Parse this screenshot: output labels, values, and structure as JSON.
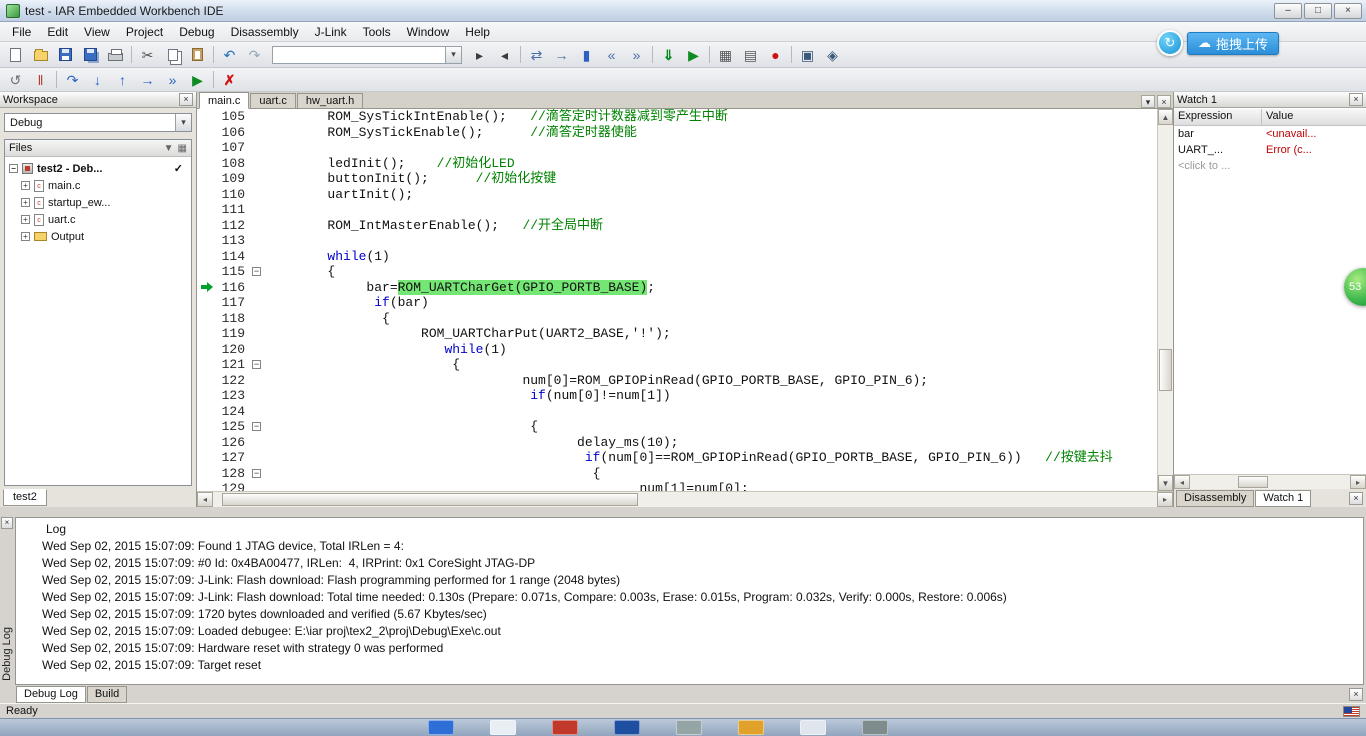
{
  "window": {
    "title": "test - IAR Embedded Workbench IDE"
  },
  "titlebar_icons": {
    "minimize": "–",
    "maximize": "□",
    "close": "×"
  },
  "menu": {
    "items": [
      "File",
      "Edit",
      "View",
      "Project",
      "Debug",
      "Disassembly",
      "J-Link",
      "Tools",
      "Window",
      "Help"
    ]
  },
  "toolbar_main": {
    "items": [
      {
        "t": "btn",
        "name": "new-file",
        "icon": "page"
      },
      {
        "t": "btn",
        "name": "open-file",
        "icon": "folder"
      },
      {
        "t": "btn",
        "name": "save",
        "icon": "floppy"
      },
      {
        "t": "btn",
        "name": "save-all",
        "icon": "floppy2"
      },
      {
        "t": "btn",
        "name": "print",
        "icon": "printer"
      },
      {
        "t": "sep"
      },
      {
        "t": "btn",
        "name": "cut",
        "icon": "g",
        "g": "✂",
        "c": "#50524f"
      },
      {
        "t": "btn",
        "name": "copy",
        "icon": "pages"
      },
      {
        "t": "btn",
        "name": "paste",
        "icon": "clip"
      },
      {
        "t": "sep"
      },
      {
        "t": "btn",
        "name": "undo",
        "icon": "g",
        "g": "↶",
        "c": "#1d6fb8"
      },
      {
        "t": "btn",
        "name": "redo",
        "icon": "g",
        "g": "↷",
        "c": "#94a8b8"
      },
      {
        "t": "combo",
        "name": "find-combo"
      },
      {
        "t": "btn",
        "name": "find-next",
        "icon": "g",
        "g": "▸",
        "c": "#3a3c3a"
      },
      {
        "t": "btn",
        "name": "find-previous",
        "icon": "g",
        "g": "◂",
        "c": "#3a3c3a"
      },
      {
        "t": "sep"
      },
      {
        "t": "btn",
        "name": "replace",
        "icon": "g",
        "g": "⇄",
        "c": "#4a6ea8"
      },
      {
        "t": "btn",
        "name": "goto-line",
        "icon": "g",
        "g": "→",
        "c": "#4a6ea8"
      },
      {
        "t": "btn",
        "name": "toggle-bookmark",
        "icon": "g",
        "g": "▮",
        "c": "#2d62c4"
      },
      {
        "t": "btn",
        "name": "previous-bookmark",
        "icon": "g",
        "g": "«",
        "c": "#4a6ea8"
      },
      {
        "t": "btn",
        "name": "next-bookmark",
        "icon": "g",
        "g": "»",
        "c": "#4a6ea8"
      },
      {
        "t": "sep"
      },
      {
        "t": "btn",
        "name": "download-and-debug",
        "icon": "g",
        "g": "⇓",
        "c": "#0d8a22",
        "b": 1
      },
      {
        "t": "btn",
        "name": "debug-without-downloading",
        "icon": "g",
        "g": "▶",
        "c": "#0d8a22"
      },
      {
        "t": "sep"
      },
      {
        "t": "btn",
        "name": "make",
        "icon": "g",
        "g": "▦",
        "c": "#56585a"
      },
      {
        "t": "btn",
        "name": "compile",
        "icon": "g",
        "g": "▤",
        "c": "#56585a"
      },
      {
        "t": "btn",
        "name": "toggle-breakpoint",
        "icon": "g",
        "g": "●",
        "c": "#cc1111"
      },
      {
        "t": "sep"
      },
      {
        "t": "btn",
        "name": "jlink-control-panel",
        "icon": "g",
        "g": "▣",
        "c": "#3a5a7a"
      },
      {
        "t": "btn",
        "name": "jlink-memory",
        "icon": "g",
        "g": "◈",
        "c": "#3a5a7a"
      }
    ]
  },
  "toolbar_debug": {
    "items": [
      {
        "t": "btn",
        "name": "reset",
        "icon": "g",
        "g": "↺",
        "c": "#6f7276"
      },
      {
        "t": "btn",
        "name": "break",
        "icon": "g",
        "g": "‖",
        "c": "#b33a2a"
      },
      {
        "t": "sep"
      },
      {
        "t": "btn",
        "name": "step-over",
        "icon": "g",
        "g": "↷",
        "c": "#2d62c4"
      },
      {
        "t": "btn",
        "name": "step-into",
        "icon": "g",
        "g": "↓",
        "c": "#2d62c4"
      },
      {
        "t": "btn",
        "name": "step-out",
        "icon": "g",
        "g": "↑",
        "c": "#2d62c4"
      },
      {
        "t": "btn",
        "name": "next-statement",
        "icon": "g",
        "g": "→",
        "c": "#2d62c4"
      },
      {
        "t": "btn",
        "name": "run-to-cursor",
        "icon": "g",
        "g": "»",
        "c": "#2d62c4"
      },
      {
        "t": "btn",
        "name": "go",
        "icon": "g",
        "g": "▶",
        "c": "#0d8a22"
      },
      {
        "t": "sep"
      },
      {
        "t": "btn",
        "name": "stop-debugging",
        "icon": "g",
        "g": "✗",
        "c": "#d31515",
        "b": 1
      }
    ]
  },
  "overlay": {
    "upload_label": "拖拽上传",
    "upload_icon": "↻",
    "cloud_icon": "☁",
    "ball_label": "53"
  },
  "workspace": {
    "title": "Workspace",
    "config": "Debug",
    "files_header": "Files",
    "project": {
      "label": "test2 - Deb...",
      "check": "✓"
    },
    "tree": [
      {
        "label": "main.c",
        "icon": "c-file"
      },
      {
        "label": "startup_ew...",
        "icon": "c-file"
      },
      {
        "label": "uart.c",
        "icon": "c-file"
      },
      {
        "label": "Output",
        "icon": "folder"
      }
    ],
    "bottom_tab": "test2"
  },
  "editor": {
    "tabs": [
      {
        "label": "main.c",
        "active": true
      },
      {
        "label": "uart.c",
        "active": false
      },
      {
        "label": "hw_uart.h",
        "active": false
      }
    ],
    "lines": [
      {
        "n": 105,
        "s": [
          {
            "t": "        ROM_SysTickIntEnable();   "
          },
          {
            "t": "//滴答定时计数器减到零产生中断",
            "c": "c"
          }
        ]
      },
      {
        "n": 106,
        "s": [
          {
            "t": "        ROM_SysTickEnable();      "
          },
          {
            "t": "//滴答定时器使能",
            "c": "c"
          }
        ]
      },
      {
        "n": 107,
        "s": []
      },
      {
        "n": 108,
        "s": [
          {
            "t": "        ledInit();    "
          },
          {
            "t": "//初始化LED",
            "c": "c"
          }
        ]
      },
      {
        "n": 109,
        "s": [
          {
            "t": "        buttonInit();      "
          },
          {
            "t": "//初始化按键",
            "c": "c"
          }
        ]
      },
      {
        "n": 110,
        "s": [
          {
            "t": "        uartInit();"
          }
        ]
      },
      {
        "n": 111,
        "s": []
      },
      {
        "n": 112,
        "s": [
          {
            "t": "        ROM_IntMasterEnable();   "
          },
          {
            "t": "//开全局中断",
            "c": "c"
          }
        ]
      },
      {
        "n": 113,
        "s": []
      },
      {
        "n": 114,
        "s": [
          {
            "t": "        "
          },
          {
            "t": "while",
            "c": "k"
          },
          {
            "t": "(1)"
          }
        ]
      },
      {
        "n": 115,
        "fold": true,
        "s": [
          {
            "t": "        {"
          }
        ]
      },
      {
        "n": 116,
        "arrow": true,
        "s": [
          {
            "t": "             bar="
          },
          {
            "t": "ROM_UARTCharGet(GPIO_PORTB_BASE)",
            "c": "hl"
          },
          {
            "t": ";"
          }
        ]
      },
      {
        "n": 117,
        "s": [
          {
            "t": "              "
          },
          {
            "t": "if",
            "c": "k"
          },
          {
            "t": "(bar)"
          }
        ]
      },
      {
        "n": 118,
        "s": [
          {
            "t": "               {"
          }
        ]
      },
      {
        "n": 119,
        "s": [
          {
            "t": "                    ROM_UARTCharPut(UART2_BASE,'!');"
          }
        ]
      },
      {
        "n": 120,
        "s": [
          {
            "t": "                       "
          },
          {
            "t": "while",
            "c": "k"
          },
          {
            "t": "(1)"
          }
        ]
      },
      {
        "n": 121,
        "fold": true,
        "s": [
          {
            "t": "                        {"
          }
        ]
      },
      {
        "n": 122,
        "s": [
          {
            "t": "                                 num[0]=ROM_GPIOPinRead(GPIO_PORTB_BASE, GPIO_PIN_6);"
          }
        ]
      },
      {
        "n": 123,
        "s": [
          {
            "t": "                                  "
          },
          {
            "t": "if",
            "c": "k"
          },
          {
            "t": "(num[0]!=num[1])"
          }
        ]
      },
      {
        "n": 124,
        "s": []
      },
      {
        "n": 125,
        "fold": true,
        "s": [
          {
            "t": "                                  {"
          }
        ]
      },
      {
        "n": 126,
        "s": [
          {
            "t": "                                        delay_ms(10);"
          }
        ]
      },
      {
        "n": 127,
        "s": [
          {
            "t": "                                         "
          },
          {
            "t": "if",
            "c": "k"
          },
          {
            "t": "(num[0]==ROM_GPIOPinRead(GPIO_PORTB_BASE, GPIO_PIN_6))   "
          },
          {
            "t": "//按键去抖",
            "c": "c"
          }
        ]
      },
      {
        "n": 128,
        "fold": true,
        "s": [
          {
            "t": "                                          {"
          }
        ]
      },
      {
        "n": 129,
        "s": [
          {
            "t": "                                                num[1]=num[0];"
          }
        ]
      }
    ]
  },
  "watch": {
    "title": "Watch 1",
    "columns": [
      "Expression",
      "Value"
    ],
    "rows": [
      {
        "expr": "bar",
        "value": "<unavail...",
        "value_style": "err"
      },
      {
        "expr": "UART_...",
        "value": "Error (c...",
        "value_style": "err"
      },
      {
        "expr": "<click to ...",
        "value": "",
        "expr_style": "ph"
      }
    ],
    "tabs": [
      {
        "label": "Disassembly",
        "active": false
      },
      {
        "label": "Watch 1",
        "active": true
      }
    ]
  },
  "log": {
    "title": "Log",
    "side_label": "Debug Log",
    "lines": [
      "Wed Sep 02, 2015 15:07:09: Found 1 JTAG device, Total IRLen = 4:",
      "Wed Sep 02, 2015 15:07:09: #0 Id: 0x4BA00477, IRLen:  4, IRPrint: 0x1 CoreSight JTAG-DP",
      "Wed Sep 02, 2015 15:07:09: J-Link: Flash download: Flash programming performed for 1 range (2048 bytes)",
      "Wed Sep 02, 2015 15:07:09: J-Link: Flash download: Total time needed: 0.130s (Prepare: 0.071s, Compare: 0.003s, Erase: 0.015s, Program: 0.032s, Verify: 0.000s, Restore: 0.006s)",
      "Wed Sep 02, 2015 15:07:09: 1720 bytes downloaded and verified (5.67 Kbytes/sec)",
      "Wed Sep 02, 2015 15:07:09: Loaded debugee: E:\\iar proj\\tex2_2\\proj\\Debug\\Exe\\c.out",
      "Wed Sep 02, 2015 15:07:09: Hardware reset with strategy 0 was performed",
      "Wed Sep 02, 2015 15:07:09: Target reset"
    ],
    "tabs": [
      {
        "label": "Debug Log",
        "active": true
      },
      {
        "label": "Build",
        "active": false
      }
    ]
  },
  "statusbar": {
    "text": "Ready"
  },
  "taskbar": {
    "icons": [
      {
        "name": "taskbar-icon-1",
        "bg": "#2d6fd6"
      },
      {
        "name": "taskbar-icon-2",
        "bg": "#e9eef4"
      },
      {
        "name": "taskbar-icon-3",
        "bg": "#c0392b"
      },
      {
        "name": "taskbar-icon-4",
        "bg": "#1f4fa0"
      },
      {
        "name": "taskbar-icon-5",
        "bg": "#95a5a6"
      },
      {
        "name": "taskbar-icon-6",
        "bg": "#e0a22b"
      },
      {
        "name": "taskbar-icon-7",
        "bg": "#dfe6ee"
      },
      {
        "name": "taskbar-icon-8",
        "bg": "#7f8c8d"
      }
    ]
  }
}
